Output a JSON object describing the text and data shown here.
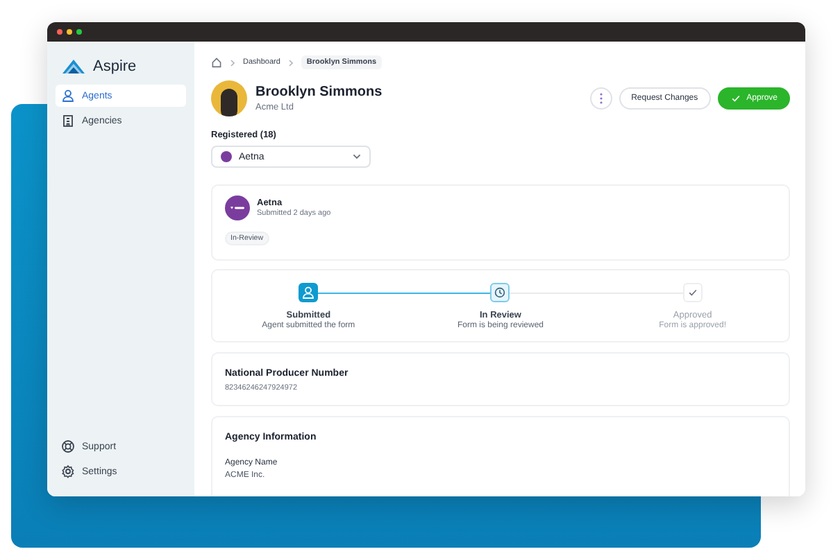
{
  "app": {
    "name": "Aspire"
  },
  "sidebar": {
    "items": [
      {
        "label": "Agents",
        "selected": true
      },
      {
        "label": "Agencies",
        "selected": false
      }
    ],
    "footer_items": [
      {
        "label": "Support"
      },
      {
        "label": "Settings"
      }
    ]
  },
  "breadcrumb": [
    {
      "label": "Dashboard",
      "current": false
    },
    {
      "label": "Brooklyn Simmons",
      "current": true
    }
  ],
  "profile": {
    "name": "Brooklyn Simmons",
    "company": "Acme Ltd"
  },
  "actions": [
    {
      "kind": "more"
    },
    {
      "kind": "secondary",
      "label": "Request Changes"
    },
    {
      "kind": "primary",
      "label": "Approve"
    }
  ],
  "registered": {
    "label": "Registered (18)",
    "selected": "Aetna"
  },
  "submission": {
    "name": "Aetna",
    "meta": "Submitted 2 days ago",
    "badge": "In-Review"
  },
  "steps": [
    {
      "kind": "done",
      "title": "Submitted",
      "subtitle": "Agent submitted the form"
    },
    {
      "kind": "current",
      "title": "In Review",
      "subtitle": "Form is being reviewed"
    },
    {
      "kind": "pending",
      "title": "Approved",
      "subtitle": "Form is approved!"
    }
  ],
  "npn": {
    "title": "National Producer Number",
    "value": "82346246247924972"
  },
  "agency": {
    "title": "Agency Information",
    "field_label": "Agency Name",
    "field_value": "ACME Inc."
  }
}
